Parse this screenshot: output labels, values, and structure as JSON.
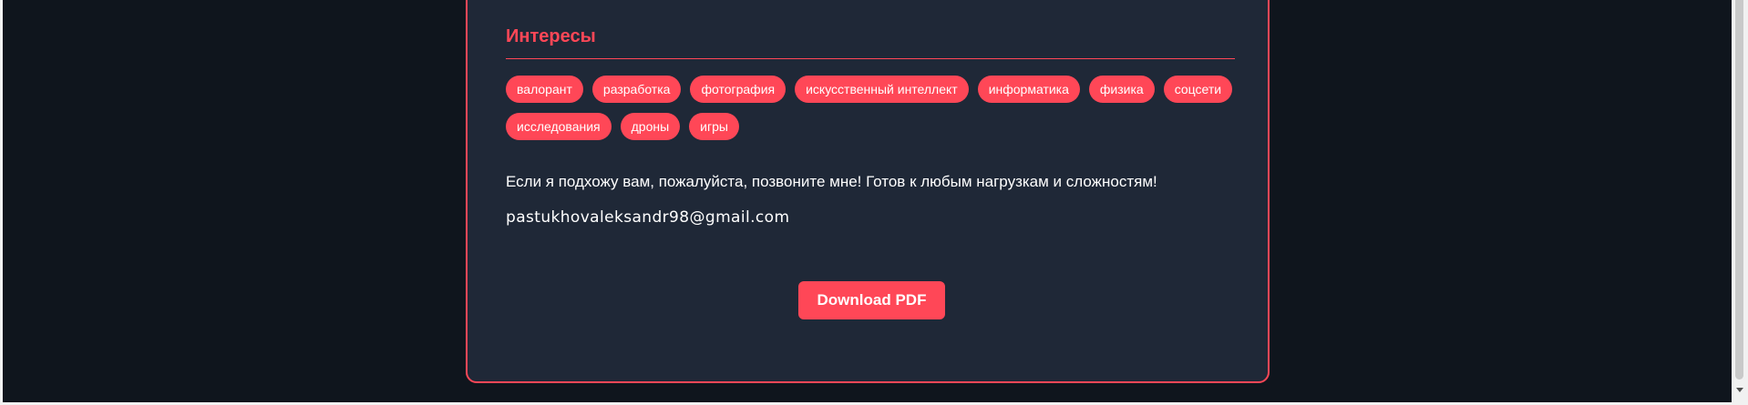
{
  "interests": {
    "title": "Интересы",
    "tags": [
      "валорант",
      "разработка",
      "фотография",
      "искусственный интеллект",
      "информатика",
      "физика",
      "соцсети",
      "исследования",
      "дроны",
      "игры"
    ]
  },
  "contact": {
    "message": "Если я подхожу вам, пожалуйста, позвоните мне! Готов к любым нагрузкам и сложностям!",
    "email": "pastukhovaleksandr98@gmail.com"
  },
  "actions": {
    "download_label": "Download PDF"
  },
  "colors": {
    "accent": "#ff4757",
    "page_background": "#0f151d",
    "card_background": "#1f2837"
  }
}
